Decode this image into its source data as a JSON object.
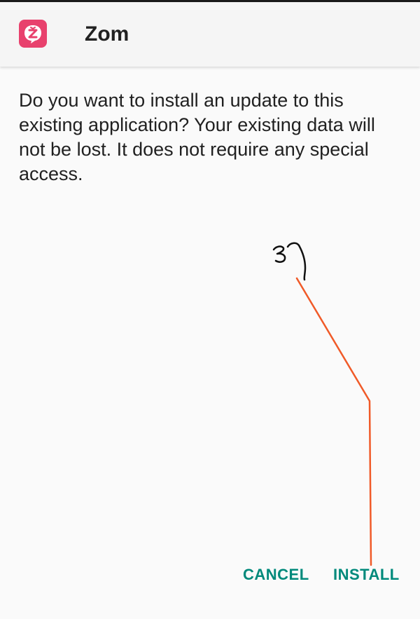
{
  "header": {
    "app_icon": "zom-app-icon",
    "app_name": "Zom"
  },
  "dialog": {
    "message": "Do you want to install an update to this existing application? Your existing data will not be lost. It does not require any special access.",
    "cancel_label": "CANCEL",
    "install_label": "INSTALL"
  },
  "annotation": {
    "handwritten_mark": "Tibetan handwritten glyph pointing to Install",
    "line_color": "#f05a28"
  },
  "colors": {
    "accent": "#00897b",
    "icon_bg": "#e8416d"
  }
}
